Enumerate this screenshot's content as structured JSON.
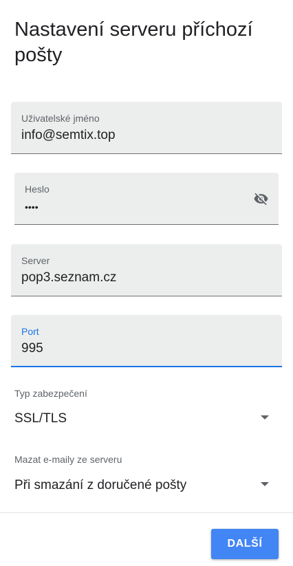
{
  "page": {
    "title": "Nastavení serveru příchozí pošty"
  },
  "fields": {
    "username": {
      "label": "Uživatelské jméno",
      "value": "info@semtix.top"
    },
    "password": {
      "label": "Heslo",
      "value": "••••",
      "toggle_icon": "visibility-off-icon"
    },
    "server": {
      "label": "Server",
      "value": "pop3.seznam.cz"
    },
    "port": {
      "label": "Port",
      "value": "995",
      "focused": true
    }
  },
  "security": {
    "label": "Typ zabezpečení",
    "selected": "SSL/TLS"
  },
  "delete_mail": {
    "label": "Mazat e-maily ze serveru",
    "selected": "Při smazání z doručené pošty"
  },
  "footer": {
    "next_label": "DALŠÍ"
  },
  "colors": {
    "accent": "#1a73e8",
    "button": "#4285f4",
    "field_bg": "#eceeed"
  }
}
